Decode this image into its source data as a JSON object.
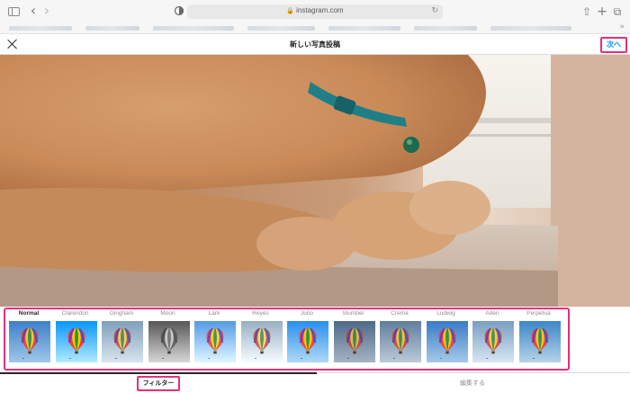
{
  "browser": {
    "address": "instagram.com",
    "lock_glyph": "🔒",
    "reload_glyph": "↻",
    "back_glyph": "‹",
    "forward_glyph": "›",
    "share_glyph": "⇧",
    "new_tab_glyph": "+",
    "tabs_glyph": "⧉",
    "more_glyph": "»"
  },
  "header": {
    "title": "新しい写真投稿",
    "next_label": "次へ",
    "highlight_color": "#e4307c",
    "link_color": "#0095f6"
  },
  "filters": {
    "items": [
      {
        "name": "Normal",
        "tone": "normal",
        "active": true
      },
      {
        "name": "Clarendon",
        "tone": "clarendon",
        "active": false
      },
      {
        "name": "Gingham",
        "tone": "gingham",
        "active": false
      },
      {
        "name": "Moon",
        "tone": "moon",
        "active": false
      },
      {
        "name": "Lark",
        "tone": "lark",
        "active": false
      },
      {
        "name": "Reyes",
        "tone": "reyes",
        "active": false
      },
      {
        "name": "Juno",
        "tone": "juno",
        "active": false
      },
      {
        "name": "Slumber",
        "tone": "slumber",
        "active": false
      },
      {
        "name": "Crema",
        "tone": "crema",
        "active": false
      },
      {
        "name": "Ludwig",
        "tone": "ludwig",
        "active": false
      },
      {
        "name": "Aden",
        "tone": "aden",
        "active": false
      },
      {
        "name": "Perpetua",
        "tone": "perpetua",
        "active": false
      }
    ]
  },
  "tabs": {
    "filter_label": "フィルター",
    "edit_label": "編集する"
  }
}
